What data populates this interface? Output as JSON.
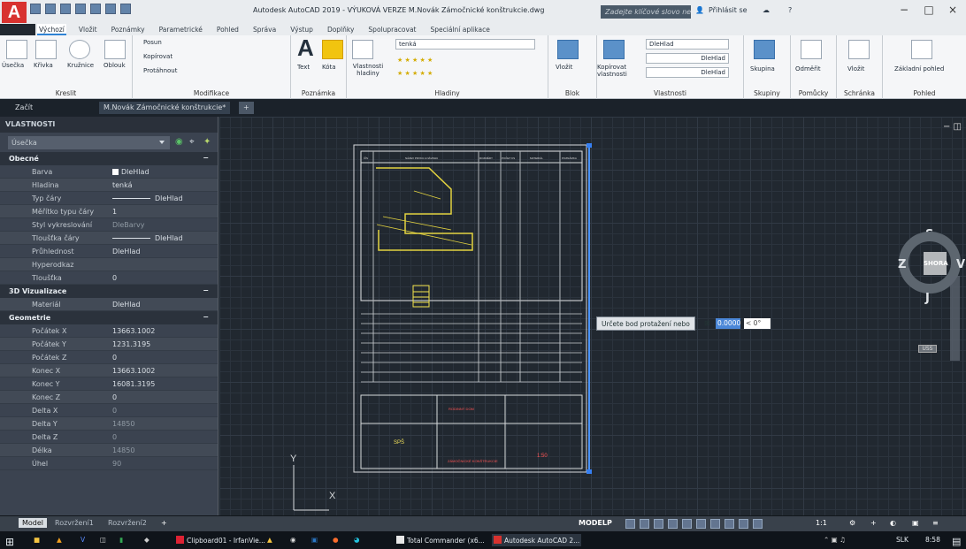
{
  "window": {
    "title": "Autodesk AutoCAD 2019 - VÝUKOVÁ VERZE   M.Novák Zámočnické konštrukcie.dwg",
    "search_placeholder": "Zadejte klíčové slovo nebo výraz.",
    "user": "Přihlásit se"
  },
  "ribbon": {
    "tabs": [
      "Výchozí",
      "Vložit",
      "Poznámky",
      "Parametrické",
      "Pohled",
      "Správa",
      "Výstup",
      "Doplňky",
      "Spolupracovat",
      "Speciální aplikace"
    ],
    "groups": [
      {
        "name": "Kreslit",
        "items": [
          "Úsečka",
          "Křivka",
          "Kružnice",
          "Oblouk"
        ]
      },
      {
        "name": "Modifikace",
        "items": [
          "Posun",
          "Kopírovat",
          "Protáhnout"
        ]
      },
      {
        "name": "Poznámka",
        "items": [
          "Text",
          "Kóta"
        ]
      },
      {
        "name": "Hladiny",
        "items": [
          "Vlastnosti hladiny",
          "tenká"
        ]
      },
      {
        "name": "Blok",
        "items": [
          "Vložit"
        ]
      },
      {
        "name": "Vlastnosti",
        "items": [
          "Kopírovat vlastnosti",
          "DleHlad",
          "DleHlad",
          "DleHlad"
        ]
      },
      {
        "name": "Skupiny",
        "items": [
          "Skupina"
        ]
      },
      {
        "name": "Pomůcky",
        "items": [
          "Odměřit"
        ]
      },
      {
        "name": "Schránka",
        "items": [
          "Vložit"
        ]
      },
      {
        "name": "Pohled",
        "items": [
          "Základní pohled"
        ]
      }
    ]
  },
  "doc_tabs": [
    "Začít",
    "M.Novák Zámočnické konštrukcie*"
  ],
  "properties": {
    "title": "VLASTNOSTI",
    "selection": "Úsečka",
    "sections": [
      {
        "title": "Obecné",
        "rows": [
          {
            "name": "Barva",
            "value": "DleHlad",
            "type": "swatch"
          },
          {
            "name": "Hladina",
            "value": "tenká"
          },
          {
            "name": "Typ čáry",
            "value": "DleHlad",
            "type": "line"
          },
          {
            "name": "Měřítko typu čáry",
            "value": "1"
          },
          {
            "name": "Styl vykreslování",
            "value": "DleBarvy",
            "dim": true
          },
          {
            "name": "Tloušťka čáry",
            "value": "DleHlad",
            "type": "line"
          },
          {
            "name": "Průhlednost",
            "value": "DleHlad"
          },
          {
            "name": "Hyperodkaz",
            "value": ""
          },
          {
            "name": "Tloušťka",
            "value": "0"
          }
        ]
      },
      {
        "title": "3D Vizualizace",
        "rows": [
          {
            "name": "Materiál",
            "value": "DleHlad"
          }
        ]
      },
      {
        "title": "Geometrie",
        "rows": [
          {
            "name": "Počátek X",
            "value": "13663.1002"
          },
          {
            "name": "Počátek Y",
            "value": "1231.3195"
          },
          {
            "name": "Počátek Z",
            "value": "0"
          },
          {
            "name": "Konec X",
            "value": "13663.1002"
          },
          {
            "name": "Konec Y",
            "value": "16081.3195"
          },
          {
            "name": "Konec Z",
            "value": "0"
          },
          {
            "name": "Delta X",
            "value": "0",
            "dim": true
          },
          {
            "name": "Delta Y",
            "value": "14850",
            "dim": true
          },
          {
            "name": "Delta Z",
            "value": "0",
            "dim": true
          },
          {
            "name": "Délka",
            "value": "14850",
            "dim": true
          },
          {
            "name": "Úhel",
            "value": "90",
            "dim": true
          }
        ]
      }
    ]
  },
  "viewcube": {
    "top": "SHORA",
    "n": "S",
    "s": "J",
    "w": "Z",
    "e": "V",
    "wcs": "USS"
  },
  "command": {
    "prompt": "Určete bod protažení nebo",
    "value": "0.0000",
    "angle": "< 0°"
  },
  "drawing": {
    "table_header": [
      "ČÍS",
      "NÁZEV PRVKU A NÁVRHU",
      "ROZMĚRY",
      "POČET KS",
      "MATERIÁL",
      "POZNÁMKA"
    ],
    "title": "RODINNÝ DOM",
    "subtitle": "ZÁMOČNICKÉ KONŠTRUKCIE",
    "school": "SPŠ",
    "scale": "1:50"
  },
  "layout_tabs": [
    "Model",
    "Rozvržení1",
    "Rozvržení2"
  ],
  "status": {
    "mode": "MODELP",
    "scale": "1:1"
  },
  "taskbar": {
    "apps": [
      "Clipboard01 - IrfanVie...",
      "Total Commander (x6...",
      "Autodesk AutoCAD 2..."
    ],
    "language": "SLK",
    "time": "8:58"
  },
  "colors": {
    "accent": "#2f83d4",
    "canvas": "#212830",
    "panel": "#3b4350",
    "brand": "#d8322f"
  }
}
